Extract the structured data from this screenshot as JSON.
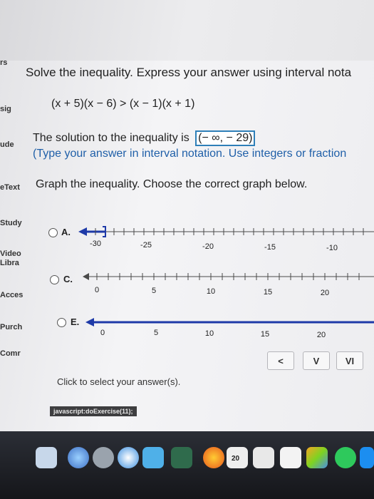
{
  "sidebar": {
    "items": [
      "rs",
      "sig",
      "ude",
      "eText",
      "Study",
      "Video\nLibra",
      "Acces",
      "Purch",
      "Comr"
    ]
  },
  "question": {
    "heading": "Solve the inequality. Express your answer using interval nota",
    "expression": "(x + 5)(x − 6) > (x − 1)(x + 1)",
    "solution_prefix": "The solution to the inequality is",
    "solution_answer": "(− ∞, − 29)",
    "hint": "(Type your answer in interval notation. Use integers or fraction",
    "graph_instruction": "Graph the inequality. Choose the correct graph below."
  },
  "options": [
    {
      "label": "A.",
      "ticks": [
        "-30",
        "-25",
        "-20",
        "-15",
        "-10"
      ]
    },
    {
      "label": "C.",
      "ticks": [
        "0",
        "5",
        "10",
        "15",
        "20"
      ]
    },
    {
      "label": "E.",
      "ticks": [
        "0",
        "5",
        "10",
        "15",
        "20"
      ]
    }
  ],
  "nav": {
    "prev": "<",
    "mid1": "V",
    "mid2": "VI",
    "next": ">"
  },
  "footer": {
    "click_hint": "Click to select your answer(s).",
    "status": "javascript:doExercise(11);"
  },
  "dock": {
    "calendar_day": "20"
  },
  "colors": {
    "accent": "#1f5fa8",
    "line": "#1e3aa8",
    "answer_border": "#2e7fb8"
  }
}
